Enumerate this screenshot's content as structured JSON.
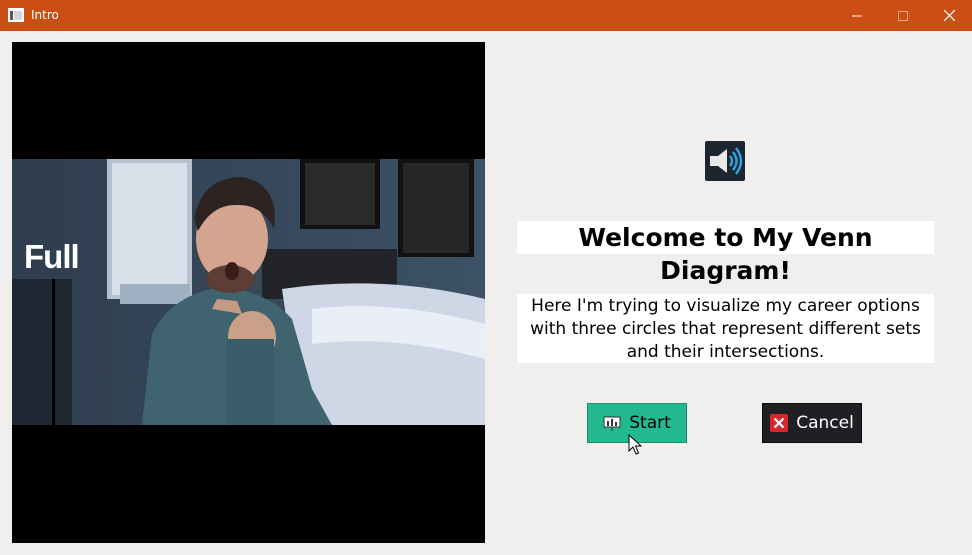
{
  "window": {
    "title": "Intro"
  },
  "titlebar": {
    "minimize_icon": "minimize-icon",
    "maximize_icon": "maximize-icon",
    "close_icon": "close-icon"
  },
  "video": {
    "overlay_text": "Full"
  },
  "main": {
    "sound_icon": "speaker-icon",
    "welcome": "Welcome to My Venn Diagram!",
    "description": "Here I'm trying to visualize my career options with three circles that represent different sets and their intersections."
  },
  "buttons": {
    "start_label": "Start",
    "cancel_label": "Cancel"
  },
  "colors": {
    "titlebar": "#cb4f14",
    "start_button": "#22b990",
    "cancel_button": "#1f2024",
    "cancel_icon": "#d9262a"
  }
}
